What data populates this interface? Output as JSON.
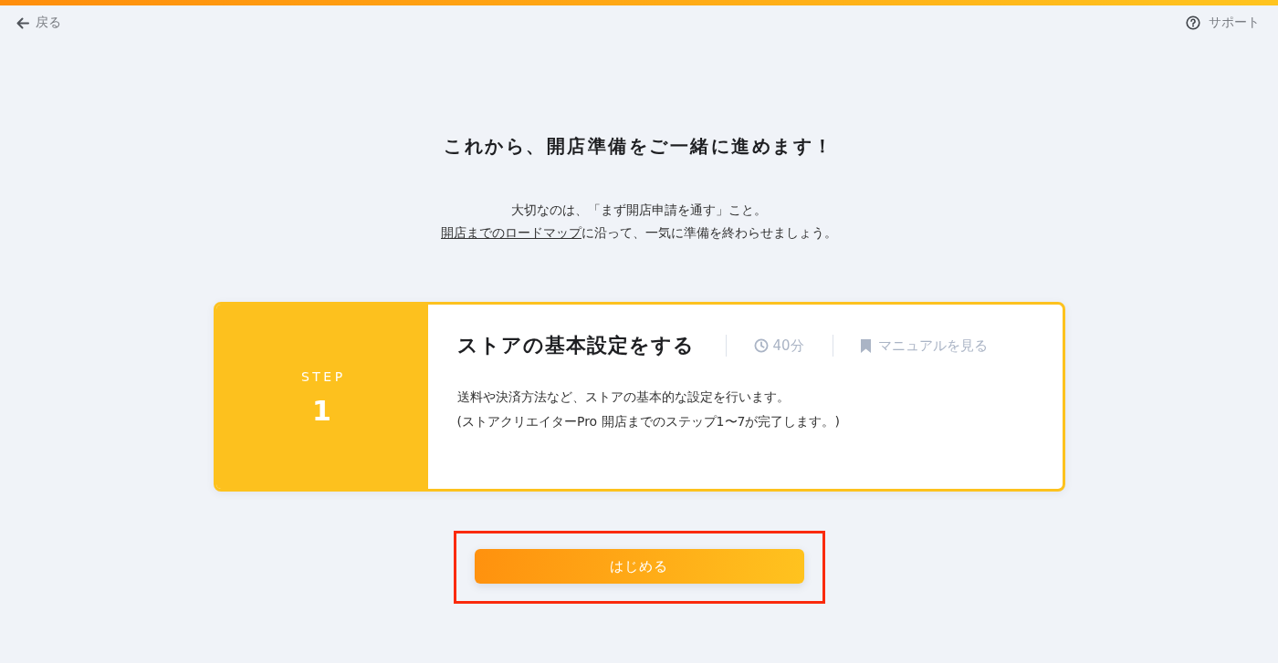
{
  "header": {
    "back_link": {
      "label": "戻る"
    },
    "support_link": {
      "label": "サポート"
    }
  },
  "intro": {
    "title": "これから、開店準備をご一緒に進めます！",
    "lines": [
      [
        {
          "kind": "text",
          "text": "大切なのは、「まず開店申請を通す」こと。"
        }
      ],
      [
        {
          "kind": "link",
          "text": "開店までのロードマップ"
        },
        {
          "kind": "text",
          "text": "に沿って、一気に準備を終わらせましょう。"
        }
      ]
    ]
  },
  "step_card": {
    "step_label": "STEP",
    "step_number": "1",
    "title": "ストアの基本設定をする",
    "duration": "40分",
    "manual_link": "マニュアルを見る",
    "description": [
      "送料や決済方法など、ストアの基本的な設定を行います。",
      "(ストアクリエイターPro 開店までのステップ1〜7が完了します。)"
    ]
  },
  "start_button": {
    "label": "はじめる"
  }
}
